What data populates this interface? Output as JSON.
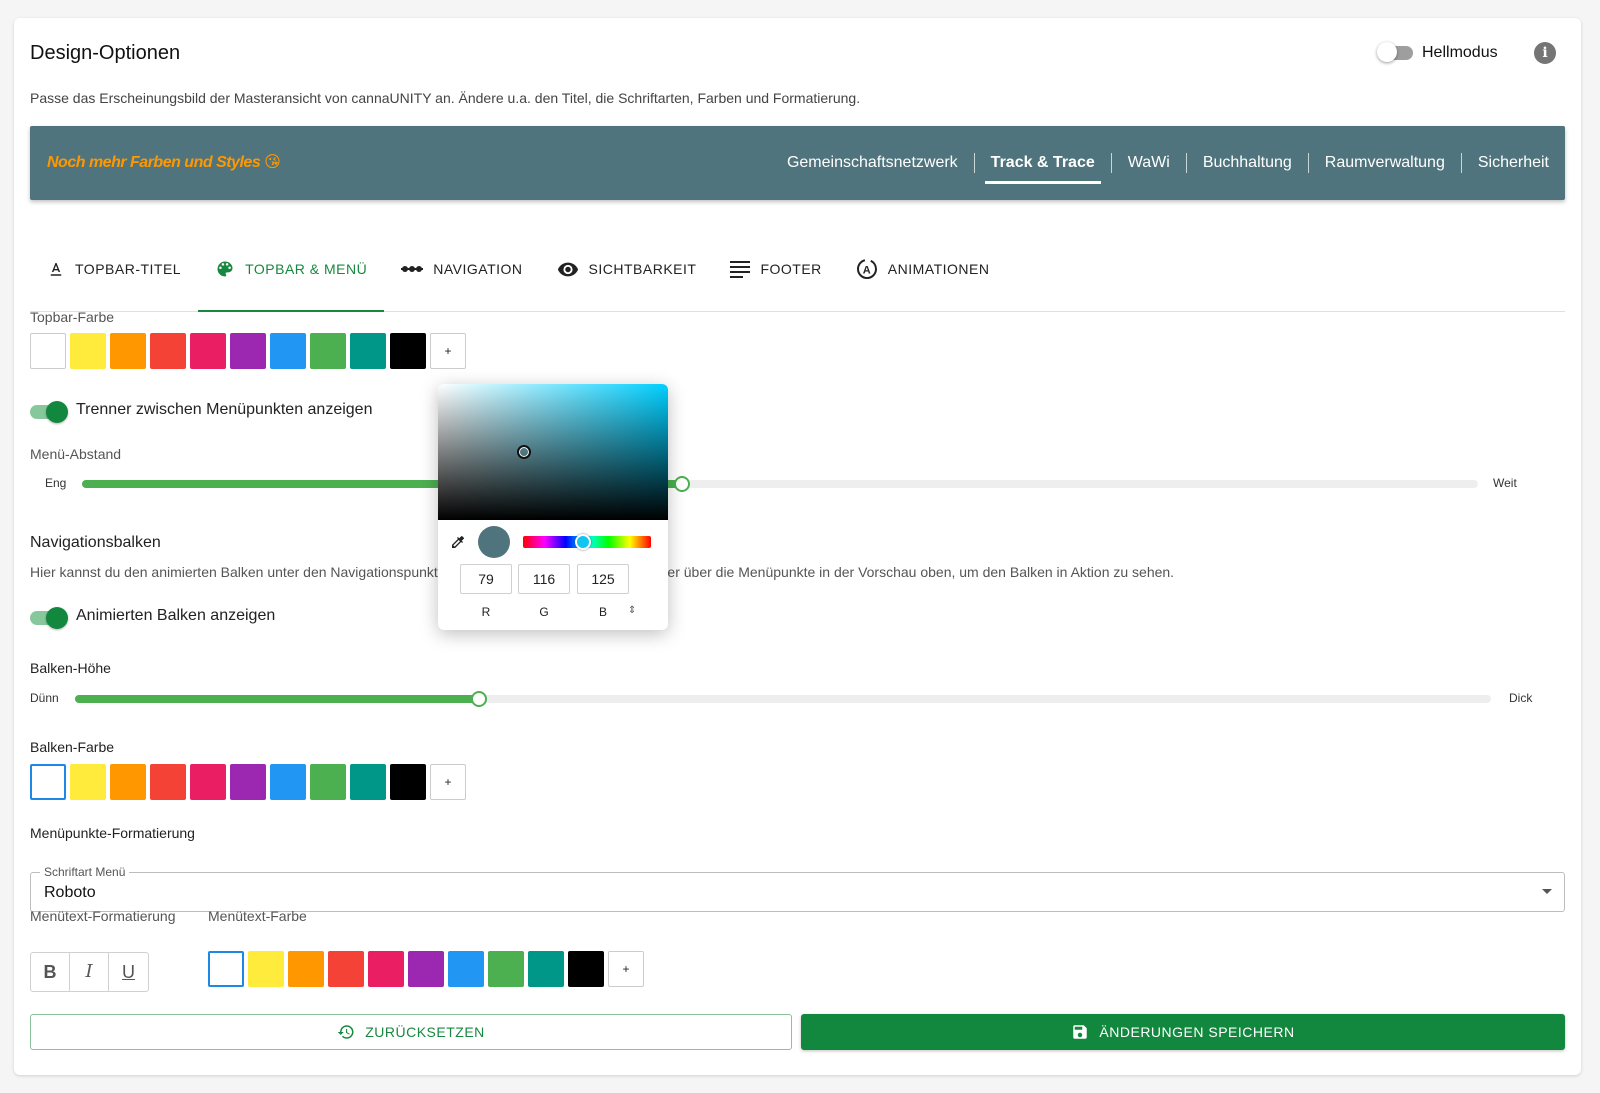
{
  "page": {
    "title": "Design-Optionen",
    "subtitle": "Passe das Erscheinungsbild der Masteransicht von cannaUNITY an. Ändere u.a. den Titel, die Schriftarten, Farben und Formatierung.",
    "light_mode_label": "Hellmodus",
    "light_mode_on": false
  },
  "preview": {
    "title": "Noch mehr Farben und Styles 😘",
    "background": "#4f747d",
    "menu": [
      "Gemeinschaftsnetzwerk",
      "Track & Trace",
      "WaWi",
      "Buchhaltung",
      "Raumverwaltung",
      "Sicherheit"
    ],
    "active_index": 1
  },
  "tabs": [
    {
      "label": "TOPBAR-TITEL",
      "icon": "text-format-icon"
    },
    {
      "label": "TOPBAR & MENÜ",
      "icon": "palette-icon",
      "active": true
    },
    {
      "label": "NAVIGATION",
      "icon": "commit-icon"
    },
    {
      "label": "SICHTBARKEIT",
      "icon": "eye-icon"
    },
    {
      "label": "FOOTER",
      "icon": "notes-icon"
    },
    {
      "label": "ANIMATIONEN",
      "icon": "animation-icon"
    }
  ],
  "colors": [
    "#ffffff",
    "#ffeb3b",
    "#ff9800",
    "#f44336",
    "#e91e63",
    "#9c27b0",
    "#2196f3",
    "#4caf50",
    "#009688",
    "#000000"
  ],
  "plus_label": "+",
  "topbar_color": {
    "label": "Topbar-Farbe"
  },
  "separator_toggle": {
    "label": "Trenner zwischen Menüpunkten anzeigen",
    "on": true
  },
  "menu_spacing": {
    "label": "Menü-Abstand",
    "min_label": "Eng",
    "max_label": "Weit",
    "value": 0.43
  },
  "navbar": {
    "heading": "Navigationsbalken",
    "description": "Hier kannst du den animierten Balken unter den Navigationspunkten anpassen. Bewege den Mauszeiger über die Menüpunkte in der Vorschau oben, um den Balken in Aktion zu sehen.",
    "toggle_label": "Animierten Balken anzeigen",
    "toggle_on": true
  },
  "bar_height": {
    "label": "Balken-Höhe",
    "min_label": "Dünn",
    "max_label": "Dick",
    "value": 0.285
  },
  "bar_color": {
    "label": "Balken-Farbe"
  },
  "menu_format": {
    "heading": "Menüpunkte-Formatierung",
    "font_legend": "Schriftart Menü",
    "font_value": "Roboto",
    "text_format_label": "Menütext-Formatierung",
    "bold": "B",
    "italic": "I",
    "underline": "U",
    "text_color_label": "Menütext-Farbe"
  },
  "buttons": {
    "reset": "ZURÜCKSETZEN",
    "save": "ÄNDERUNGEN SPEICHERN"
  },
  "picker": {
    "r": "79",
    "g": "116",
    "b": "125",
    "r_label": "R",
    "g_label": "G",
    "b_label": "B",
    "current_color": "#4f747d",
    "hue_position": 0.47
  }
}
